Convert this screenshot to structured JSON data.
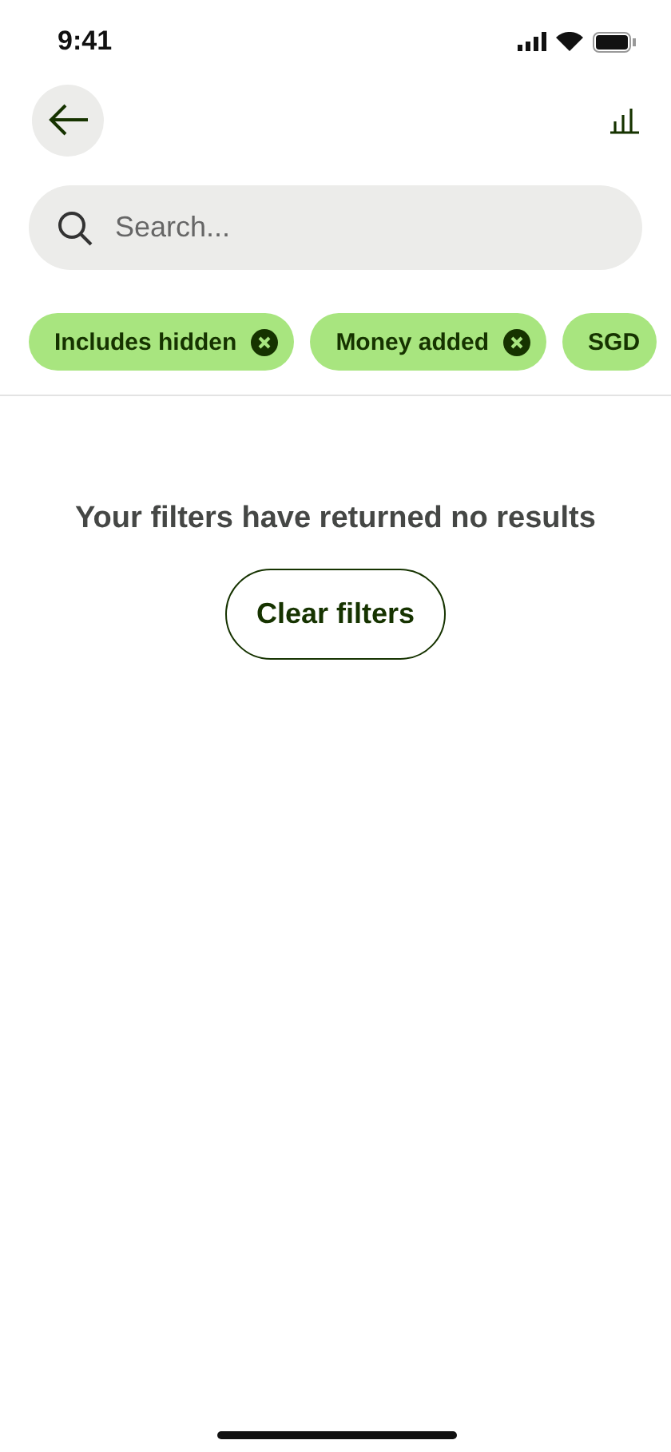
{
  "status_bar": {
    "time": "9:41"
  },
  "search": {
    "placeholder": "Search..."
  },
  "filters": [
    {
      "label": "Includes hidden",
      "removable": true
    },
    {
      "label": "Money added",
      "removable": true
    },
    {
      "label": "SGD",
      "removable": false
    }
  ],
  "empty_state": {
    "message": "Your filters have returned no results",
    "button": "Clear filters"
  }
}
